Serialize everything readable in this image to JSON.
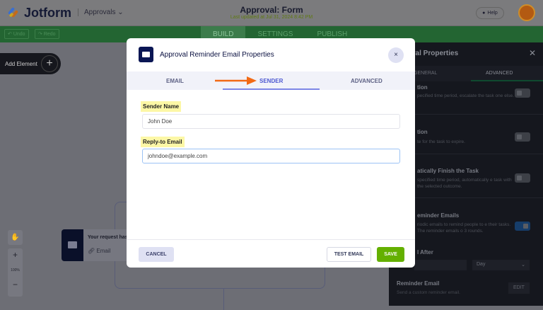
{
  "header": {
    "logo": "Jotform",
    "app_selector": "Approvals",
    "title": "Approval: Form",
    "last_updated": "Last updated at Jul 31, 2024 8:42 PM",
    "help": "Help"
  },
  "toolbar": {
    "undo": "Undo",
    "redo": "Redo",
    "tabs": [
      "BUILD",
      "SETTINGS",
      "PUBLISH"
    ]
  },
  "canvas": {
    "add_element": "Add Element",
    "zoom_level": "100%",
    "node_title": "Your request has",
    "node_type": "Email"
  },
  "right_panel": {
    "title": "val Properties",
    "tabs": [
      "GENERAL",
      "ADVANCED"
    ],
    "sections": [
      {
        "title": "tion",
        "desc": "pecified time period, escalate the task one else."
      },
      {
        "title": "tion",
        "desc": "te for the task to expire."
      },
      {
        "title": "atically Finish the Task",
        "desc": "specified time period, automatically e task with the selected outcome."
      },
      {
        "title": "eminder Emails",
        "desc": "riodic emails to remind people to e their tasks. The reminder emails o 3 rounds."
      }
    ],
    "send_after": "l After",
    "unit": "Day",
    "reminder_title": "Reminder Email",
    "reminder_desc": "Send a custom reminder email.",
    "edit": "EDIT"
  },
  "modal": {
    "title": "Approval Reminder Email Properties",
    "close": "×",
    "tabs": [
      "EMAIL",
      "SENDER",
      "ADVANCED"
    ],
    "sender_name_label": "Sender Name",
    "sender_name_value": "John Doe",
    "reply_to_label": "Reply-to Email",
    "reply_to_value": "johndoe@example.com",
    "cancel": "CANCEL",
    "test_email": "TEST EMAIL",
    "save": "SAVE"
  },
  "colors": {
    "accent": "#4b57d1",
    "save": "#64b000",
    "arrow": "#f26a15",
    "highlight": "#fcf7a6"
  }
}
